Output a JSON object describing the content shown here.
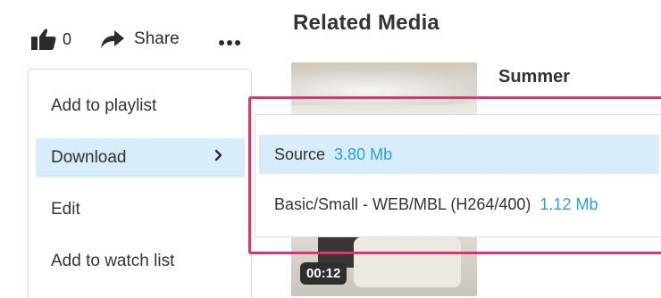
{
  "actions": {
    "like_count": "0",
    "share_label": "Share"
  },
  "related": {
    "title": "Related Media",
    "item_title": "Summer",
    "duration": "00:12"
  },
  "menu": {
    "items": [
      {
        "label": "Add to playlist"
      },
      {
        "label": "Download"
      },
      {
        "label": "Edit"
      },
      {
        "label": "Add to watch list"
      }
    ]
  },
  "download_options": [
    {
      "label": "Source",
      "size": "3.80 Mb"
    },
    {
      "label": "Basic/Small - WEB/MBL (H264/400)",
      "size": "1.12 Mb"
    }
  ],
  "colors": {
    "accent_blue": "#2d9fd8",
    "highlight_bg": "#d7ecf8",
    "annotation_pink": "#d8366f"
  }
}
